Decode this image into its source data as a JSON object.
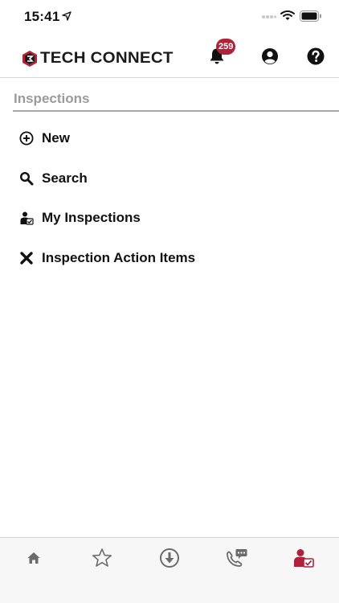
{
  "status_bar": {
    "time": "15:41",
    "icons": [
      "location-arrow-icon",
      "signal-dots-icon",
      "wifi-icon",
      "battery-icon"
    ]
  },
  "header": {
    "logo_text": "TECH CONNECT",
    "notification_count": "259",
    "icons": [
      "bell-icon",
      "user-icon",
      "help-icon"
    ],
    "badge_color": "#b0213a"
  },
  "section": {
    "title": "Inspections"
  },
  "menu": {
    "items": [
      {
        "label": "New",
        "icon": "add-circle-icon"
      },
      {
        "label": "Search",
        "icon": "search-icon"
      },
      {
        "label": "My Inspections",
        "icon": "inspector-icon"
      },
      {
        "label": "Inspection Action Items",
        "icon": "x-icon"
      }
    ]
  },
  "tabbar": {
    "tabs": [
      {
        "icon": "home-icon",
        "active": false
      },
      {
        "icon": "star-icon",
        "active": false
      },
      {
        "icon": "download-icon",
        "active": false
      },
      {
        "icon": "phone-chat-icon",
        "active": false
      },
      {
        "icon": "inspector-tab-icon",
        "active": true
      }
    ],
    "active_color": "#b0213a",
    "inactive_color": "#6b6b6b"
  }
}
